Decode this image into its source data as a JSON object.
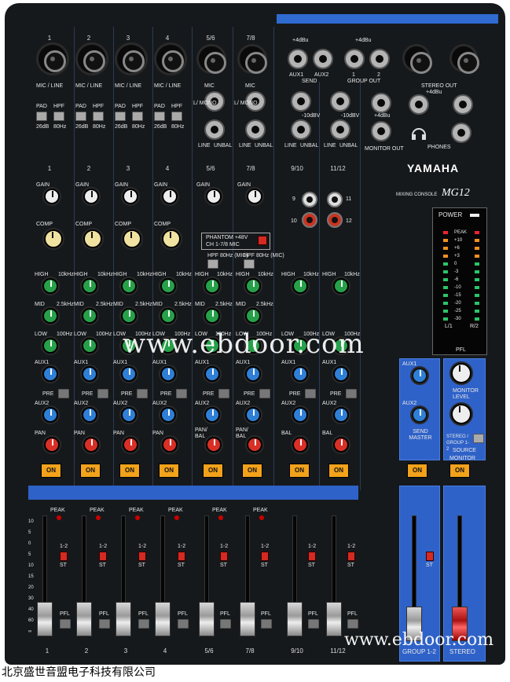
{
  "brand": {
    "logo": "YAMAHA",
    "subtitle": "MIXING CONSOLE",
    "model": "MG12"
  },
  "mono_channels": [
    {
      "number": "1",
      "input_label": "MIC / LINE"
    },
    {
      "number": "2",
      "input_label": "MIC / LINE"
    },
    {
      "number": "3",
      "input_label": "MIC / LINE"
    },
    {
      "number": "4",
      "input_label": "MIC / LINE"
    }
  ],
  "stereo_channels": [
    {
      "number": "5/6",
      "input_label": "MIC"
    },
    {
      "number": "7/8",
      "input_label": "MIC"
    },
    {
      "number": "9/10",
      "input_label": ""
    },
    {
      "number": "11/12",
      "input_label": ""
    }
  ],
  "labels": {
    "pad": "PAD",
    "pad_db": "26dB",
    "hpf": "HPF",
    "hpf_hz": "80Hz",
    "gain": "GAIN",
    "comp": "COMP",
    "high": "HIGH",
    "high_freq": "10kHz",
    "mid": "MID",
    "mid_freq": "2.5kHz",
    "low": "LOW",
    "low_freq": "100Hz",
    "aux1": "AUX1",
    "aux2": "AUX2",
    "pre": "PRE",
    "pan": "PAN",
    "bal": "BAL",
    "pan_bal": "PAN/ BAL",
    "on": "ON",
    "peak": "PEAK",
    "pfl": "PFL",
    "st": "ST",
    "one_two": "1-2",
    "line": "LINE",
    "unbal": "UNBAL",
    "mono": "L/ MONO",
    "l": "L",
    "r": "R",
    "plus4": "+4dBu",
    "minus10": "-10dBV",
    "phantom": "PHANTOM +48V",
    "phantom_ch": "CH 1-7/8 MIC",
    "hpf_mic": "HPF 80Hz (MIC)"
  },
  "top_right": {
    "send": "SEND",
    "aux1": "AUX1",
    "aux2": "AUX2",
    "group_out": "GROUP OUT",
    "group_1": "1",
    "group_2": "2",
    "stereo_out": "STEREO OUT",
    "stereo_out_level": "+4dBu",
    "monitor_out": "MONITOR OUT",
    "phones": "PHONES"
  },
  "rca": {
    "ch9": "9",
    "ch10": "10",
    "ch11": "11",
    "ch12": "12"
  },
  "master": {
    "power": "POWER",
    "send_master": "SEND MASTER",
    "monitor_level": "MONITOR LEVEL",
    "stereo_group": "STEREO / GROUP 1-2",
    "source": "SOURCE",
    "monitor": "MONITOR",
    "group_fader": "GROUP 1-2",
    "stereo_fader": "STEREO",
    "pfl": "PFL",
    "l1": "L/1",
    "r2": "R/2",
    "peak": "PEAK"
  },
  "meter_scale": [
    "PEAK",
    "+10",
    "+6",
    "+3",
    "0",
    "-3",
    "-6",
    "-10",
    "-15",
    "-20",
    "-25",
    "-30"
  ],
  "fader_scale": [
    "10",
    "5",
    "0",
    "5",
    "10",
    "15",
    "20",
    "30",
    "40",
    "60",
    "∞"
  ],
  "watermark": {
    "center": "www.ebdoor.com",
    "bottom": "www.ebdoor.com"
  },
  "footer": "北京盛世音盟电子科技有限公司",
  "colors": {
    "blue_panel": "#2f62c8",
    "on_button": "#f2a21b",
    "eq_knob": "#27a04a",
    "aux_knob": "#2f7fd6",
    "pan_knob": "#d83027"
  }
}
